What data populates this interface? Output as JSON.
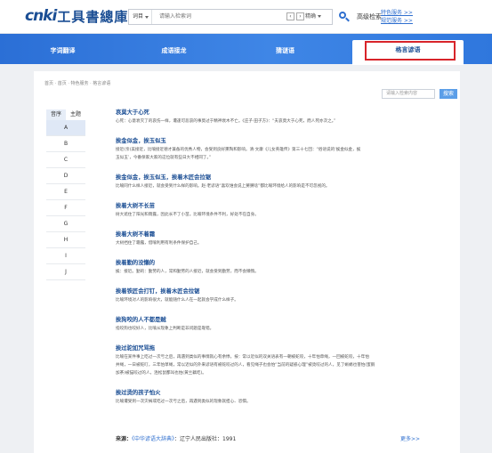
{
  "header": {
    "logo_cnki": "cnki",
    "logo_title": "工具書總庫",
    "scope_label": "词目",
    "search_placeholder": "请输入检索词",
    "mode_label": "精确",
    "advanced_search": "高级检索",
    "links": [
      "特色服务 >>",
      "规范服务 >>"
    ]
  },
  "nav": {
    "tabs": [
      {
        "label": "字词翻译",
        "active": false
      },
      {
        "label": "成语接龙",
        "active": false
      },
      {
        "label": "猜谜语",
        "active": false
      },
      {
        "label": "格言谚语",
        "active": true
      }
    ]
  },
  "content": {
    "breadcrumb": "首页 · 首页 · 特色服务 · 格言谚语",
    "filter_placeholder": "请输入检索内容",
    "filter_button": "搜索",
    "side_tabs": [
      "音序",
      "主题"
    ],
    "letters": [
      "A",
      "B",
      "C",
      "D",
      "E",
      "F",
      "G",
      "H",
      "I",
      "J"
    ],
    "idioms": [
      {
        "title": "哀莫大于心死",
        "lines": [
          "心死：心意衰灭了的哀伤一样，遭逢可悲哀的事莫过于精神衰木不亡。《庄子·田子方》：“夫哀莫大于心死，而人死亦次之。”"
        ]
      },
      {
        "title": "挨金似金，挨玉似玉",
        "lines": [
          "接近(亲)美接近，比喻接近德才兼备的优秀人物，会受到良好熏陶和影响。清·文康《儿女英雄传》第三十七回：“俗语说的‘挨金似金，挨",
          "玉似玉’，今番保家大家的这位就有些日大不相同了。”"
        ]
      },
      {
        "title": "挨金似金，挨玉似玉，挨着木匠会拉锯",
        "lines": [
          "比喻同什么样人接近，就会受到什么样的影响。赵·老谚语“喜欢谁会说上舅舅啥”都比喻环境给人的影响是不可忽视的。"
        ]
      },
      {
        "title": "挨着大树不长苗",
        "lines": [
          "树大遮住了阳光和雨露，因此长不了小苗。比喻环境条件不利，好处不在自身。"
        ]
      },
      {
        "title": "挨着大树不着霜",
        "lines": [
          "大树挡住了霜露，借喻利用有利条件保护自己。"
        ]
      },
      {
        "title": "挨着勤的没懒的",
        "lines": [
          "挨：接近。勤的：勤劳的人，常和勤劳的人接近，就会受到勤劳，而不会懒惰。"
        ]
      },
      {
        "title": "挨着铁匠会打钉，挨着木匠会拉锯",
        "lines": [
          "比喻环境对人的影响很大，就能随什么人在一起就会学成什么样子。"
        ]
      },
      {
        "title": "挨狗咬的人不都是贼",
        "lines": [
          "指咬狗也咬好人，比喻从现象上判断是非问题是靠错。"
        ]
      },
      {
        "title": "挨过驼如咒骂拖",
        "lines": [
          "比喻在某件事上吃过一次亏之后，再遇到类似的事情就心有余悸。按：常以近似的双关语表有一朝被蛇咬，十年怕草绳，一回被蛇咬，十年怕",
          "井绳，一日被蛇叮，三年怕草绳，常以近似的外来谚语有被蛇咬过的人，看见绳子也会怕“当前的疑惑心理”被烫咬过的人，见了蜥蜴也害怕(蜜鹅",
          "加茶)被猫咬过的人，连松鼠都叫也怕(黄兰藕吃)。"
        ]
      },
      {
        "title": "挨过烫的孩子怕火",
        "lines": [
          "比喻遭受到一次灾祸或吃过一次亏之后，再遇到类似的现象就担心、恐惧。"
        ]
      }
    ],
    "source_prefix": "来源：",
    "source_book": "《中华谚语大辞典》",
    "source_rest": "：辽宁人民出版社：1991",
    "more": "更多>>"
  },
  "colors": {
    "brand": "#1b4e94",
    "nav": "#2f77dd",
    "highlight": "#d8242a",
    "link": "#2f6fcf"
  }
}
